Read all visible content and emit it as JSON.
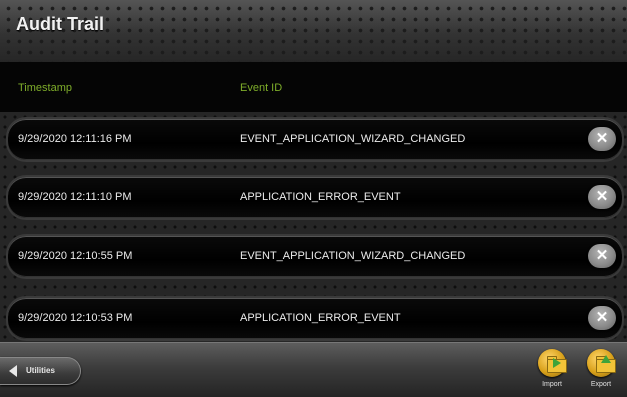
{
  "window": {
    "title": "Audit Trail"
  },
  "table": {
    "columns": [
      "Timestamp",
      "Event ID"
    ],
    "rows": [
      {
        "timestamp": "9/29/2020 12:11:16 PM",
        "event_id": "EVENT_APPLICATION_WIZARD_CHANGED",
        "delete": "✕"
      },
      {
        "timestamp": "9/29/2020 12:11:10 PM",
        "event_id": "APPLICATION_ERROR_EVENT",
        "delete": "✕"
      },
      {
        "timestamp": "9/29/2020 12:10:55 PM",
        "event_id": "EVENT_APPLICATION_WIZARD_CHANGED",
        "delete": "✕"
      },
      {
        "timestamp": "9/29/2020 12:10:53 PM",
        "event_id": "APPLICATION_ERROR_EVENT",
        "delete": "✕"
      }
    ]
  },
  "footer": {
    "back_label": "Utilities",
    "import_label": "Import",
    "export_label": "Export"
  },
  "icons": {
    "back": "left-arrow-icon",
    "delete": "close-icon",
    "import": "folder-import-icon",
    "export": "folder-export-icon"
  },
  "colors": {
    "header_text": "#7fae2a",
    "accent_gold": "#d9a11a"
  }
}
